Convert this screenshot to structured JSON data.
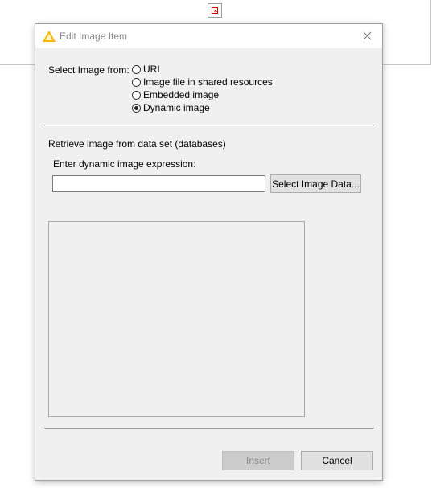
{
  "window": {
    "title": "Edit Image Item"
  },
  "image_source": {
    "label": "Select Image from:",
    "options": [
      {
        "label": "URI",
        "checked": false
      },
      {
        "label": "Image file in shared resources",
        "checked": false
      },
      {
        "label": "Embedded image",
        "checked": false
      },
      {
        "label": "Dynamic image",
        "checked": true
      }
    ]
  },
  "dynamic": {
    "section_label": "Retrieve image from data set (databases)",
    "expression_label": "Enter dynamic image expression:",
    "expression_value": "",
    "select_button": "Select Image Data..."
  },
  "footer": {
    "insert_label": "Insert",
    "insert_enabled": false,
    "cancel_label": "Cancel"
  },
  "icons": {
    "title_icon": "warning-triangle-icon",
    "close": "close-icon",
    "broken_image": "broken-image-icon"
  }
}
